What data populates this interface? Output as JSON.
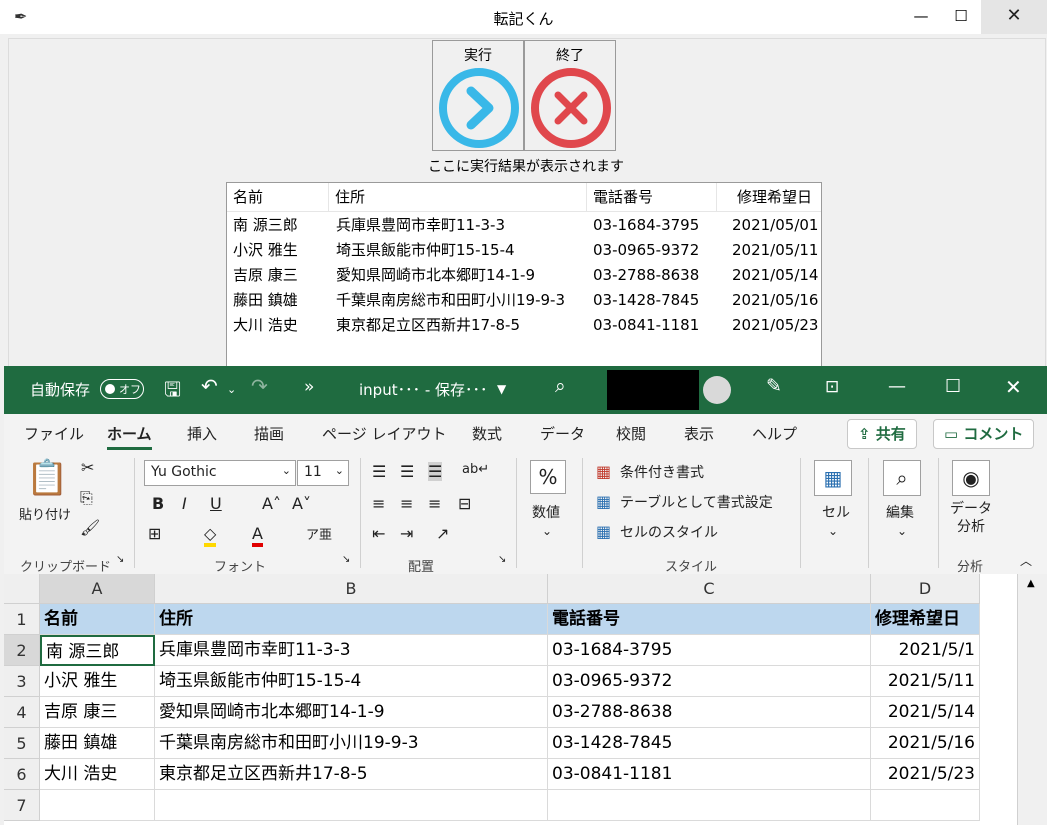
{
  "app": {
    "title": "転記くん",
    "feather": "feather-icon"
  },
  "buttons": {
    "run_label": "実行",
    "quit_label": "終了"
  },
  "status_text": "ここに実行結果が表示されます",
  "tree": {
    "columns": [
      "名前",
      "住所",
      "電話番号",
      "修理希望日"
    ],
    "rows": [
      [
        "南 源三郎",
        "兵庫県豊岡市幸町11-3-3",
        "03-1684-3795",
        "2021/05/01"
      ],
      [
        "小沢 雅生",
        "埼玉県飯能市仲町15-15-4",
        "03-0965-9372",
        "2021/05/11"
      ],
      [
        "吉原 康三",
        "愛知県岡崎市北本郷町14-1-9",
        "03-2788-8638",
        "2021/05/14"
      ],
      [
        "藤田 鎮雄",
        "千葉県南房総市和田町小川19-9-3",
        "03-1428-7845",
        "2021/05/16"
      ],
      [
        "大川 浩史",
        "東京都足立区西新井17-8-5",
        "03-0841-1181",
        "2021/05/23"
      ]
    ]
  },
  "excel": {
    "autosave_label": "自動保存",
    "autosave_state": "オフ",
    "file_title": "input･･･ - 保存･･･",
    "more": "»",
    "menu": [
      "ファイル",
      "ホーム",
      "挿入",
      "描画",
      "ページ レイアウト",
      "数式",
      "データ",
      "校閲",
      "表示",
      "ヘルプ"
    ],
    "share_label": "共有",
    "comment_label": "コメント",
    "ribbon": {
      "paste_label": "貼り付け",
      "clipboard_label": "クリップボード",
      "font_name": "Yu Gothic",
      "font_size": "11",
      "font_group_label": "フォント",
      "align_group_label": "配置",
      "number_label": "数値",
      "conditional_label": "条件付き書式",
      "table_label": "テーブルとして書式設定",
      "cellstyle_label": "セルのスタイル",
      "style_group_label": "スタイル",
      "cell_label": "セル",
      "edit_label": "編集",
      "analysis_btn_label": "データ 分析",
      "analysis_group_label": "分析"
    },
    "columns": [
      "A",
      "B",
      "C",
      "D"
    ],
    "row_numbers": [
      "1",
      "2",
      "3",
      "4",
      "5",
      "6",
      "7"
    ],
    "cells": [
      [
        "名前",
        "住所",
        "電話番号",
        "修理希望日"
      ],
      [
        "南 源三郎",
        "兵庫県豊岡市幸町11-3-3",
        "03-1684-3795",
        "2021/5/1"
      ],
      [
        "小沢 雅生",
        "埼玉県飯能市仲町15-15-4",
        "03-0965-9372",
        "2021/5/11"
      ],
      [
        "吉原 康三",
        "愛知県岡崎市北本郷町14-1-9",
        "03-2788-8638",
        "2021/5/14"
      ],
      [
        "藤田 鎮雄",
        "千葉県南房総市和田町小川19-9-3",
        "03-1428-7845",
        "2021/5/16"
      ],
      [
        "大川 浩史",
        "東京都足立区西新井17-8-5",
        "03-0841-1181",
        "2021/5/23"
      ],
      [
        "",
        "",
        "",
        ""
      ]
    ]
  },
  "colors": {
    "excel_green": "#1f6b40",
    "run_blue": "#39b8e8",
    "quit_red": "#e0474c",
    "header_fill": "#bdd7ee"
  }
}
